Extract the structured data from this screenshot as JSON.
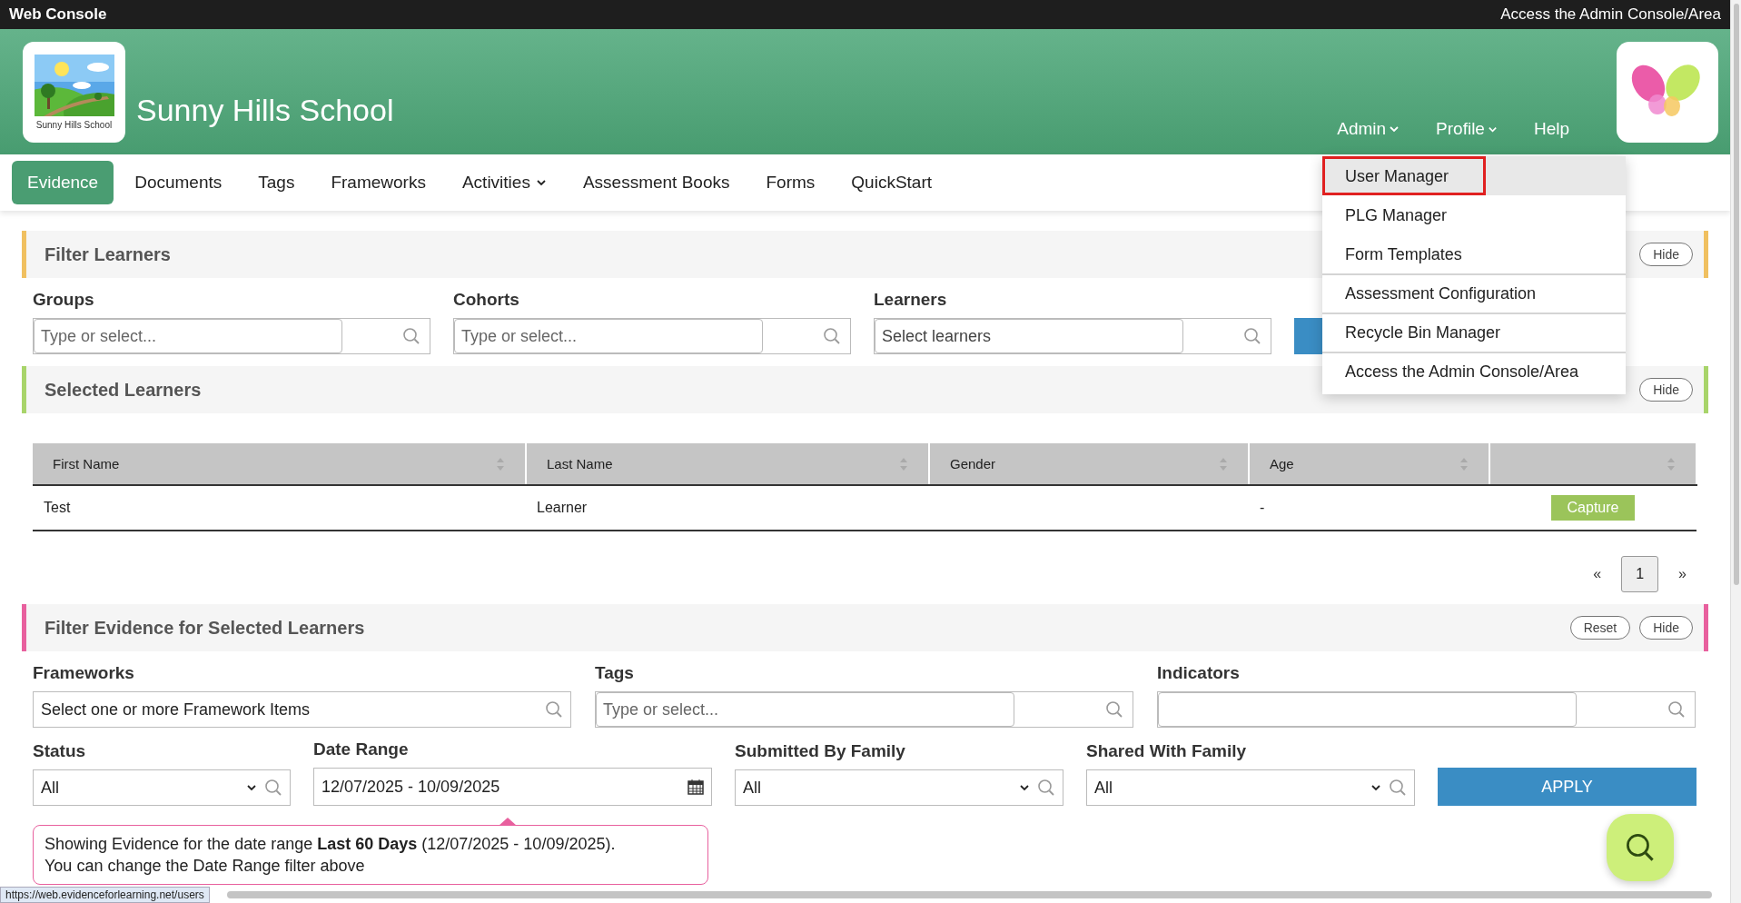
{
  "top_bar": {
    "title": "Web Console",
    "link": "Access the Admin Console/Area"
  },
  "header": {
    "school_name": "Sunny Hills School",
    "logo_caption": "Sunny Hills School",
    "menu": [
      {
        "label": "Admin",
        "dropdown": true,
        "expanded": true
      },
      {
        "label": "Profile",
        "dropdown": true,
        "expanded": false
      },
      {
        "label": "Help",
        "dropdown": false,
        "expanded": false
      }
    ]
  },
  "admin_menu": {
    "items": [
      {
        "label": "User Manager",
        "highlighted": true,
        "divider_before": false
      },
      {
        "label": "PLG Manager",
        "highlighted": false,
        "divider_before": false
      },
      {
        "label": "Form Templates",
        "highlighted": false,
        "divider_before": false
      },
      {
        "label": "Assessment Configuration",
        "highlighted": false,
        "divider_before": true
      },
      {
        "label": "Recycle Bin Manager",
        "highlighted": false,
        "divider_before": true
      },
      {
        "label": "Access the Admin Console/Area",
        "highlighted": false,
        "divider_before": true
      }
    ]
  },
  "nav": {
    "tabs": [
      {
        "label": "Evidence",
        "selected": true,
        "dropdown": false
      },
      {
        "label": "Documents",
        "selected": false,
        "dropdown": false
      },
      {
        "label": "Tags",
        "selected": false,
        "dropdown": false
      },
      {
        "label": "Frameworks",
        "selected": false,
        "dropdown": false
      },
      {
        "label": "Activities",
        "selected": false,
        "dropdown": true
      },
      {
        "label": "Assessment Books",
        "selected": false,
        "dropdown": false
      },
      {
        "label": "Forms",
        "selected": false,
        "dropdown": false
      },
      {
        "label": "QuickStart",
        "selected": false,
        "dropdown": false
      }
    ]
  },
  "filter_learners": {
    "title": "Filter Learners",
    "hide_button": "Hide",
    "fields": [
      {
        "label": "Groups",
        "placeholder": "Type or select..."
      },
      {
        "label": "Cohorts",
        "placeholder": "Type or select..."
      },
      {
        "label": "Learners",
        "placeholder": "Select learners"
      }
    ]
  },
  "selected_learners": {
    "title": "Selected Learners",
    "hide_button": "Hide",
    "table": {
      "columns": [
        "First Name",
        "Last Name",
        "Gender",
        "Age"
      ],
      "rows": [
        {
          "first_name": "Test",
          "last_name": "Learner",
          "age": "-",
          "action": "Capture"
        }
      ]
    },
    "pagination": {
      "prev": "«",
      "pages": [
        {
          "label": "1",
          "selected": true
        }
      ],
      "next": "»"
    }
  },
  "filter_evidence": {
    "title": "Filter Evidence for Selected Learners",
    "reset_button": "Reset",
    "hide_button": "Hide",
    "fields": [
      {
        "label": "Frameworks",
        "kind": "search",
        "value": "Select one or more Framework Items"
      },
      {
        "label": "Tags",
        "kind": "combo",
        "placeholder": "Type or select..."
      },
      {
        "label": "Indicators",
        "kind": "combo"
      }
    ],
    "filters": [
      {
        "label": "Status",
        "kind": "select",
        "value": "All"
      },
      {
        "label": "Date Range",
        "kind": "date",
        "value": "12/07/2025 - 10/09/2025"
      },
      {
        "label": "Submitted By Family",
        "kind": "select",
        "value": "All"
      },
      {
        "label": "Shared With Family",
        "kind": "select",
        "value": "All"
      }
    ],
    "apply_button": "APPLY",
    "notice": {
      "lines": [
        "Showing Evidence for the date range **Last 60 Days** (12/07/2025 - 10/09/2025).",
        "You can change the Date Range filter above"
      ]
    }
  },
  "status_url": "https://web.evidenceforlearning.net/users"
}
